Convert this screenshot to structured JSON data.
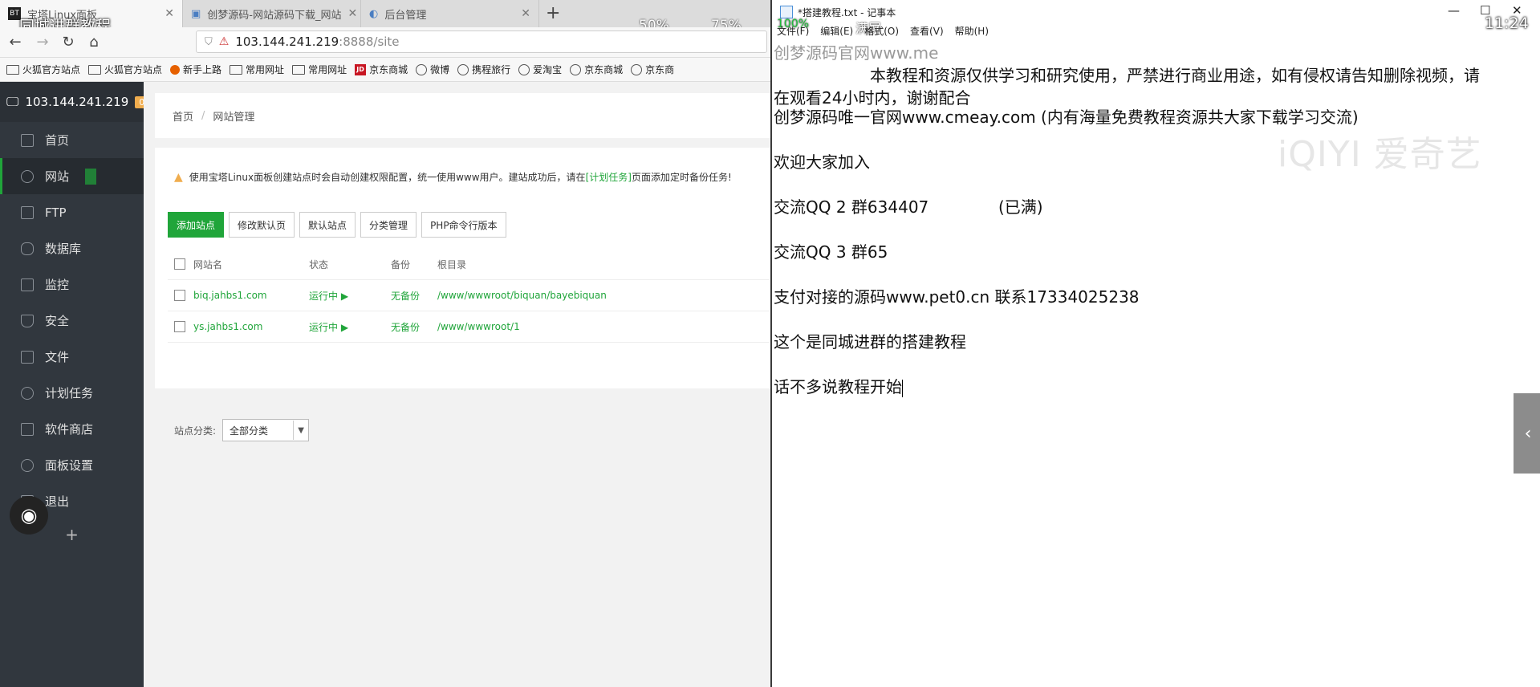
{
  "overlay": {
    "title": "同城进群教程",
    "zoom_a": "50%",
    "zoom_b": "75%",
    "clock": "11:24",
    "speed": "100%",
    "fullscreen": "满屏"
  },
  "browser": {
    "tabs": [
      {
        "label": "宝塔Linux面板",
        "icon": "BT"
      },
      {
        "label": "创梦源码-网站源码下载_网站"
      },
      {
        "label": "后台管理"
      }
    ],
    "new_tab": "+",
    "url_host": "103.144.241.219",
    "url_rest": ":8888/site",
    "bookmarks": [
      "火狐官方站点",
      "火狐官方站点",
      "新手上路",
      "常用网址",
      "常用网址",
      "京东商城",
      "微博",
      "携程旅行",
      "爱淘宝",
      "京东商城",
      "京东商"
    ]
  },
  "panel": {
    "server_ip": "103.144.241.219",
    "badge": "0",
    "menu": [
      "首页",
      "网站",
      "FTP",
      "数据库",
      "监控",
      "安全",
      "文件",
      "计划任务",
      "软件商店",
      "面板设置",
      "退出"
    ],
    "add": "+",
    "breadcrumb": {
      "home": "首页",
      "sep": "/",
      "current": "网站管理"
    },
    "notice": {
      "prefix": "使用宝塔Linux面板创建站点时会自动创建权限配置，统一使用www用户。建站成功后，请在",
      "link": "[计划任务]",
      "suffix": "页面添加定时备份任务!"
    },
    "buttons": [
      "添加站点",
      "修改默认页",
      "默认站点",
      "分类管理",
      "PHP命令行版本"
    ],
    "table": {
      "headers": [
        "网站名",
        "状态",
        "备份",
        "根目录"
      ],
      "rows": [
        {
          "name": "biq.jahbs1.com",
          "status": "运行中",
          "backup": "无备份",
          "root": "/www/wwwroot/biquan/bayebiquan"
        },
        {
          "name": "ys.jahbs1.com",
          "status": "运行中",
          "backup": "无备份",
          "root": "/www/wwwroot/1"
        }
      ]
    },
    "filter": {
      "label": "站点分类:",
      "value": "全部分类"
    }
  },
  "notepad": {
    "title": "*搭建教程.txt - 记事本",
    "menu": [
      "文件(F)",
      "编辑(E)",
      "格式(O)",
      "查看(V)",
      "帮助(H)"
    ],
    "lines": [
      "创梦源码官网www.me",
      "本教程和资源仅供学习和研究使用，严禁进行商业用途，如有侵权请告知删除视频，请",
      "在观看24小时内，谢谢配合",
      "创梦源码唯一官网www.cmeay.com (内有海量免费教程资源共大家下载学习交流)",
      "欢迎大家加入",
      "交流QQ 2 群634407",
      "(已满)",
      "交流QQ 3 群65",
      "支付对接的源码www.pet0.cn  联系17334025238",
      "这个是同城进群的搭建教程",
      "话不多说教程开始"
    ],
    "watermark": "iQIYI 爱奇艺"
  }
}
